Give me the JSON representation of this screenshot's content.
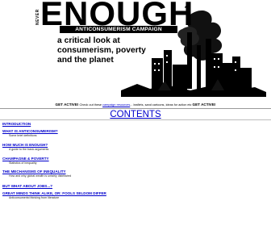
{
  "banner": {
    "logo_never": "NEVER",
    "logo_enough": "ENOUGH",
    "logo_question": "?",
    "campaign": "ANTICONSUMERISM CAMPAIGN",
    "tagline": "a critical look at consumerism, poverty and the planet"
  },
  "get_active": {
    "lead": "GET ACTIVE!",
    "text_before": "Check out these",
    "link": "campaign resources",
    "text_after": "... leaflets, sand cartoons, ideas for action etc",
    "tail": "GET ACTIVE!"
  },
  "contents": {
    "title": "CONTENTS",
    "entries": [
      {
        "title": "INTRODUCTION",
        "desc": ""
      },
      {
        "title": "WHAT IS ANTICONSUMERISM?",
        "desc": "Some brief definitions"
      },
      {
        "title": "HOW MUCH IS ENOUGH?",
        "desc": "A guide to the basic arguments"
      },
      {
        "title": "CHAMPAGNE & POVERTY",
        "desc": "Statistics of inequality"
      },
      {
        "title": "THE MECHANISMS OF INEQUALITY",
        "desc": "How and why global wealth is unfairly distributed"
      },
      {
        "title": "BUT WHAT ABOUT JOBS...?",
        "desc": ""
      },
      {
        "title": "GREAT MINDS THINK ALIKE, OR: FOOLS SELDOM DIFFER",
        "desc": "Anticonsumerist thinking from literature"
      }
    ]
  },
  "colors": {
    "link": "#0000cc",
    "ink": "#000000"
  },
  "icons": [
    "city-skyline-illustration"
  ]
}
